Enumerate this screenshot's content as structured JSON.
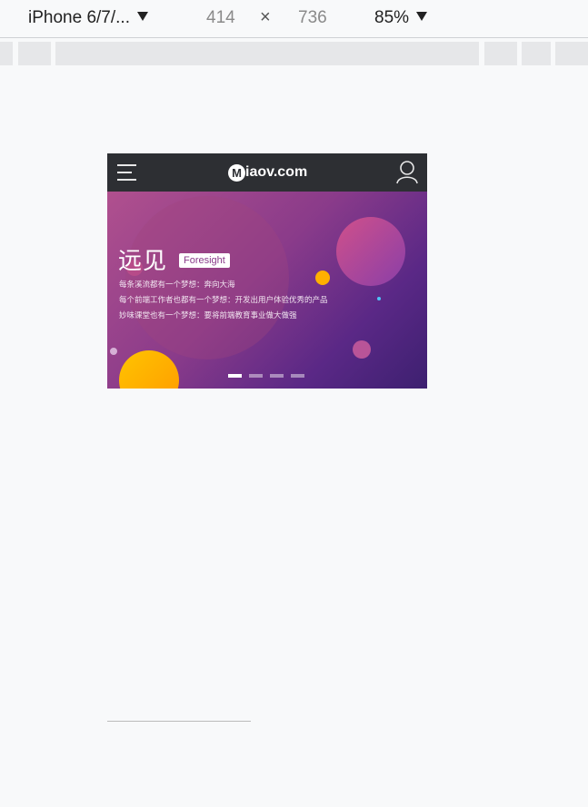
{
  "toolbar": {
    "device": "iPhone 6/7/...",
    "width": "414",
    "times": "×",
    "height": "736",
    "zoom": "85%"
  },
  "header": {
    "logo_text": "iaov.com",
    "logo_mark": "M"
  },
  "banner": {
    "title": "远见",
    "badge": "Foresight",
    "lines": [
      "每条溪流都有一个梦想：奔向大海",
      "每个前端工作者也都有一个梦想：开发出用户体验优秀的产品",
      "妙味课堂也有一个梦想：要将前端教育事业做大做强"
    ],
    "active_slide": 0,
    "slide_count": 4
  },
  "colors": {
    "header_bg": "#2d2f33",
    "accent_orange": "#ffb300"
  }
}
